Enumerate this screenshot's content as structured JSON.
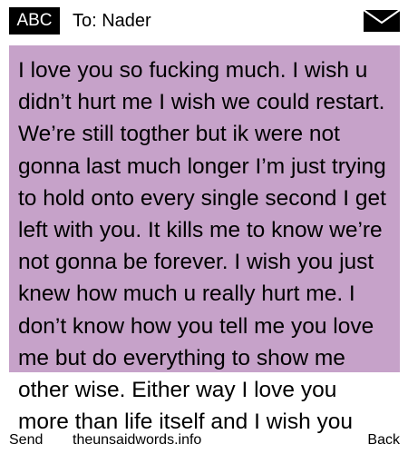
{
  "header": {
    "mode_label": "ABC",
    "to_label": "To: Nader",
    "icon": "envelope-icon"
  },
  "message": {
    "body": "I love you so fucking much. I wish u didn’t hurt me I wish we could restart. We’re still togther but ik were not gonna last much longer I’m just trying to hold onto every single second I get left with you. It kills me to know we’re not gonna be forever. I wish you just knew how much u really hurt me. I don’t know how you tell me you love me but do everything to show me other wise. Either way I love you more than life itself and I wish you"
  },
  "softkeys": {
    "left": "Send",
    "center": "theunsaidwords.info",
    "right": "Back"
  },
  "colors": {
    "highlight": "#c6a2c9",
    "badge": "#000000"
  }
}
